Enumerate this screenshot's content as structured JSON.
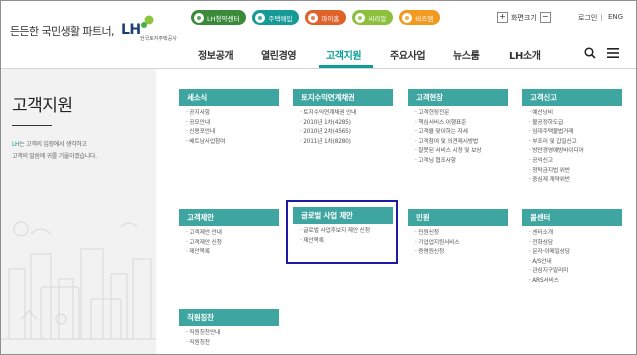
{
  "top": {
    "slogan": "든든한 국민생활 파트너,",
    "logo_text": "LH",
    "logo_sub": "한국토지주택공사",
    "pills": [
      {
        "label": "LH청약센터",
        "color": "#3a8a3a"
      },
      {
        "label": "주택매입",
        "color": "#159a96"
      },
      {
        "label": "마이홈",
        "color": "#e0612a"
      },
      {
        "label": "씨리얼",
        "color": "#8bbf3c"
      },
      {
        "label": "비즈엠",
        "color": "#f29a1f"
      }
    ],
    "zoom_plus": "+",
    "zoom_label": "화면크기",
    "zoom_minus": "−",
    "login": "로그인",
    "lang": "ENG"
  },
  "nav": {
    "items": [
      "정보공개",
      "열린경영",
      "고객지원",
      "주요사업",
      "뉴스룸",
      "LH소개"
    ],
    "active_index": 2
  },
  "left": {
    "title": "고객지원",
    "desc_highlight": "LH",
    "desc_line1_rest": "는 고객의 입장에서 생각하고",
    "desc_line2": "고객의 말씀에 귀를 기울이겠습니다."
  },
  "cards": [
    {
      "title": "세소식",
      "items": [
        "공지사항",
        "공모안내",
        "신용포안내",
        "베트남사업참여"
      ]
    },
    {
      "title": "토지수익연계채권",
      "items": [
        "토지수익연계채권 안내",
        "2010년 1차(4285)",
        "2010년 2차(4565)",
        "2011년 1차(8280)"
      ]
    },
    {
      "title": "고객현장",
      "items": [
        "고객현장전문",
        "핵심서비스 이행표준",
        "고객을 맞이하는 자세",
        "고객참여 및 의견제시방법",
        "잘못된 서비스 시정 및 보상",
        "고객님 협조사항"
      ]
    },
    {
      "title": "고객신고",
      "items": [
        "예산낭비",
        "불공정하도급",
        "임대주택불법거래",
        "부조리 및 갑질신고",
        "방만경영예방바이디어",
        "공익신고",
        "청탁금지법 위반",
        "중심제 계약위반"
      ]
    },
    {
      "title": "고객제안",
      "items": [
        "고객제안 안내",
        "고객제안 신청",
        "제안목록"
      ]
    },
    {
      "title": "글로벌 사업 제안",
      "items": [
        "글로벌 사업후보지 제안 신청",
        "제안목록"
      ]
    },
    {
      "title": "민원",
      "items": [
        "민원신청",
        "기업업지원서비스",
        "증명원신청"
      ]
    },
    {
      "title": "콜센터",
      "items": [
        "센터소개",
        "전화상담",
        "문자·이메일상담",
        "A/S안내",
        "관심지구알리미",
        "ARS서비스"
      ]
    },
    {
      "title": "직원칭찬",
      "items": [
        "직원칭찬안내",
        "직원칭찬"
      ]
    }
  ],
  "colors": {
    "accent": "#0c9d96",
    "card_header": "#3ea5a1",
    "highlight_box": "#1c1aa7"
  }
}
